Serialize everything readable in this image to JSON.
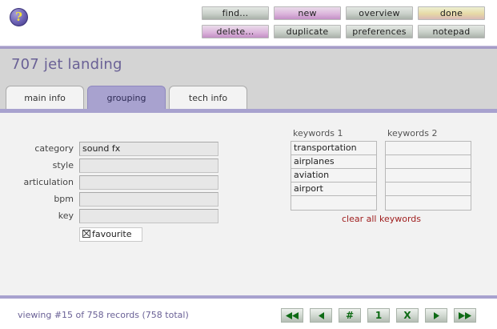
{
  "toolbar": {
    "help_glyph": "?",
    "find": "find...",
    "new": "new",
    "overview": "overview",
    "done": "done",
    "delete": "delete...",
    "duplicate": "duplicate",
    "preferences": "preferences",
    "notepad": "notepad"
  },
  "record": {
    "title": "707 jet landing"
  },
  "tabs": [
    {
      "label": "main info",
      "active": false
    },
    {
      "label": "grouping",
      "active": true
    },
    {
      "label": "tech info",
      "active": false
    }
  ],
  "form": {
    "category_label": "category",
    "category_value": "sound fx",
    "style_label": "style",
    "style_value": "",
    "articulation_label": "articulation",
    "articulation_value": "",
    "bpm_label": "bpm",
    "bpm_value": "",
    "key_label": "key",
    "key_value": "",
    "favourite_label": "favourite",
    "favourite_checked": true
  },
  "keywords": {
    "header1": "keywords 1",
    "header2": "keywords 2",
    "list1": [
      "transportation",
      "airplanes",
      "aviation",
      "airport",
      ""
    ],
    "list2": [
      "",
      "",
      "",
      "",
      ""
    ],
    "clear_label": "clear all keywords"
  },
  "footer": {
    "status": "viewing #15 of 758 records (758 total)",
    "nav": {
      "first_icon": "rewind-icon",
      "prev_icon": "triangle-left-icon",
      "goto_label": "#",
      "page_label": "1",
      "close_label": "X",
      "next_icon": "triangle-right-icon",
      "last_icon": "fast-forward-icon"
    }
  },
  "colors": {
    "accent": "#a8a2cf",
    "title": "#6a6196",
    "link_red": "#a02020",
    "nav_green": "#0d6a14"
  }
}
